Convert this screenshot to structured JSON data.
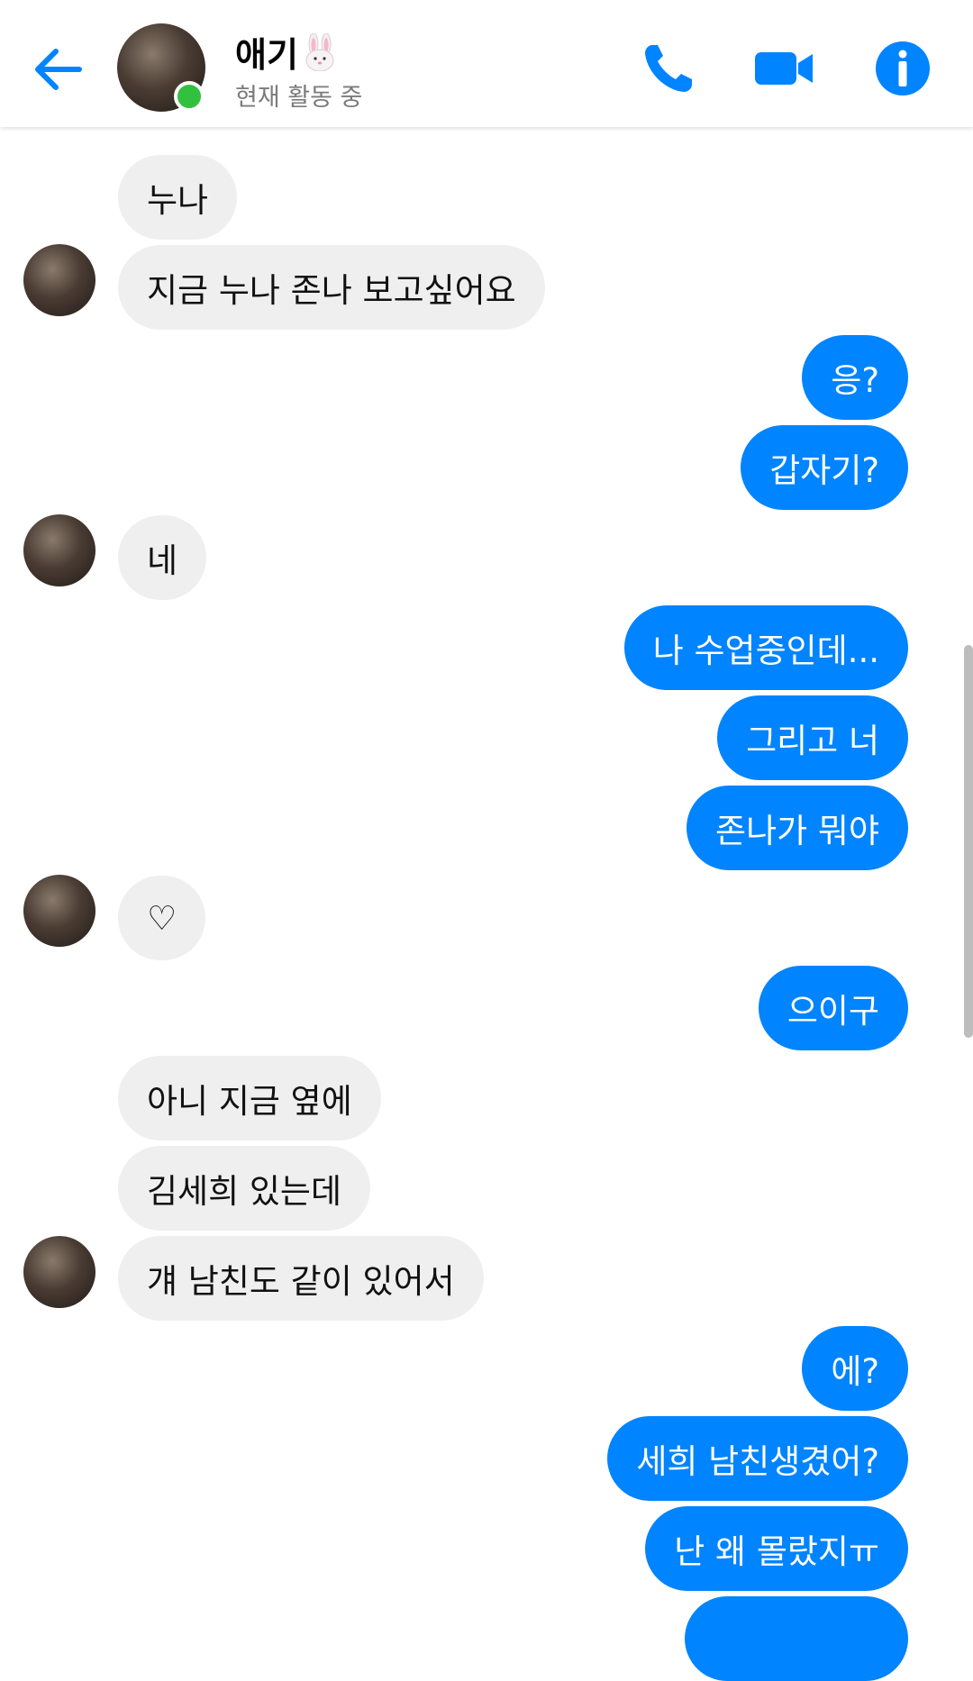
{
  "header": {
    "contact_name": "애기",
    "status": "현재 활동 중",
    "accent_color": "#0084ff",
    "icons": [
      "back-arrow-icon",
      "phone-icon",
      "video-camera-icon",
      "info-icon",
      "rabbit-emoji-icon"
    ]
  },
  "messages": [
    {
      "side": "in",
      "text": "누나"
    },
    {
      "side": "in",
      "text": "지금 누나 존나 보고싶어요"
    },
    {
      "side": "out",
      "text": "응?"
    },
    {
      "side": "out",
      "text": "갑자기?"
    },
    {
      "side": "in",
      "text": "네"
    },
    {
      "side": "out",
      "text": "나 수업중인데..."
    },
    {
      "side": "out",
      "text": "그리고 너"
    },
    {
      "side": "out",
      "text": "존나가 뭐야"
    },
    {
      "side": "in",
      "text": "♡"
    },
    {
      "side": "out",
      "text": "으이구"
    },
    {
      "side": "in",
      "text": "아니 지금 옆에"
    },
    {
      "side": "in",
      "text": "김세희 있는데"
    },
    {
      "side": "in",
      "text": "걔 남친도 같이 있어서"
    },
    {
      "side": "out",
      "text": "에?"
    },
    {
      "side": "out",
      "text": "세희 남친생겼어?"
    },
    {
      "side": "out",
      "text": "난 왜 몰랐지ㅠ"
    },
    {
      "side": "out",
      "text": ""
    }
  ]
}
